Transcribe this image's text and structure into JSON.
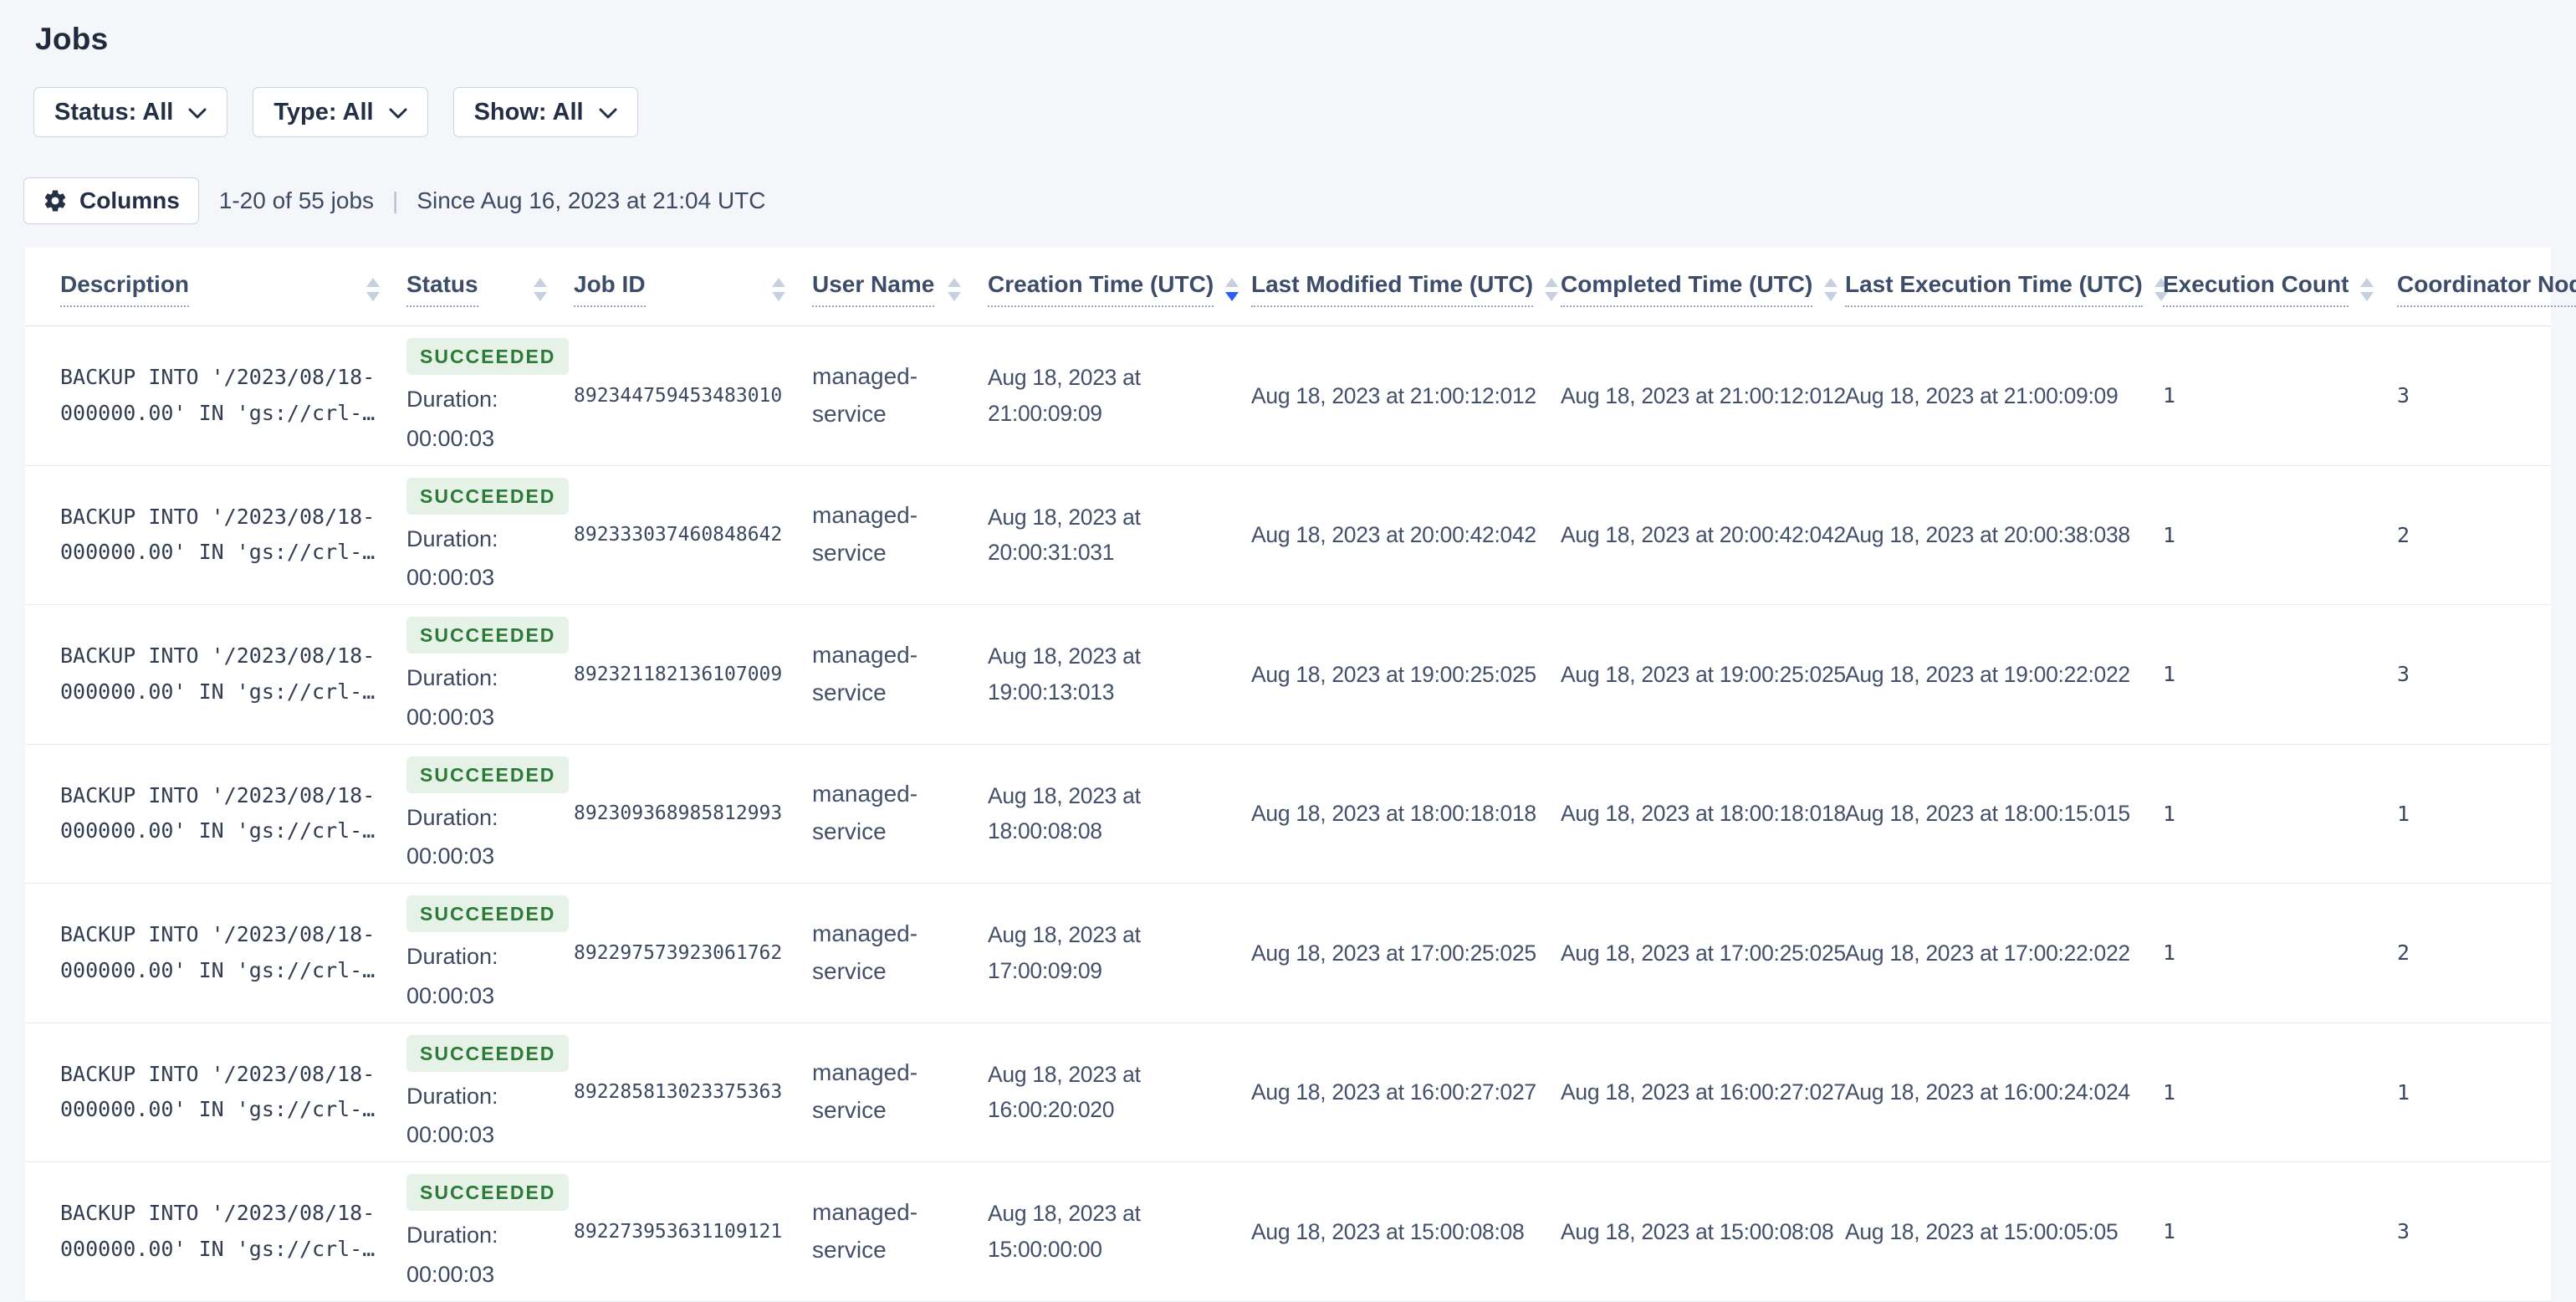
{
  "page_title": "Jobs",
  "filters": [
    {
      "label": "Status: All"
    },
    {
      "label": "Type: All"
    },
    {
      "label": "Show: All"
    }
  ],
  "toolbar": {
    "columns_button": "Columns",
    "results_count": "1-20 of 55 jobs",
    "separator": "|",
    "since": "Since Aug 16, 2023 at 21:04 UTC"
  },
  "colors": {
    "accent_blue": "#2a5ffa",
    "success_text": "#2b7a35",
    "success_bg": "#e6f2e7"
  },
  "table": {
    "columns": [
      {
        "key": "description",
        "label": "Description",
        "sort": "none"
      },
      {
        "key": "status",
        "label": "Status",
        "sort": "none"
      },
      {
        "key": "job_id",
        "label": "Job ID",
        "sort": "none"
      },
      {
        "key": "user_name",
        "label": "User Name",
        "sort": "none"
      },
      {
        "key": "creation_time",
        "label": "Creation Time (UTC)",
        "sort": "desc"
      },
      {
        "key": "last_modified_time",
        "label": "Last Modified Time (UTC)",
        "sort": "none"
      },
      {
        "key": "completed_time",
        "label": "Completed Time (UTC)",
        "sort": "none"
      },
      {
        "key": "last_execution_time",
        "label": "Last Execution Time (UTC)",
        "sort": "none"
      },
      {
        "key": "execution_count",
        "label": "Execution Count",
        "sort": "none"
      },
      {
        "key": "coordinator_node",
        "label": "Coordinator Node",
        "sort": "none"
      }
    ],
    "rows": [
      {
        "description_line1": "BACKUP INTO '/2023/08/18-",
        "description_line2": "000000.00' IN 'gs://crl-…",
        "status": "SUCCEEDED",
        "duration_label": "Duration:",
        "duration": "00:00:03",
        "job_id": "892344759453483010",
        "user_name": "managed-service",
        "creation_time": "Aug 18, 2023 at 21:00:09:09",
        "last_modified_time": "Aug 18, 2023 at 21:00:12:012",
        "completed_time": "Aug 18, 2023 at 21:00:12:012",
        "last_execution_time": "Aug 18, 2023 at 21:00:09:09",
        "execution_count": "1",
        "coordinator_node": "3"
      },
      {
        "description_line1": "BACKUP INTO '/2023/08/18-",
        "description_line2": "000000.00' IN 'gs://crl-…",
        "status": "SUCCEEDED",
        "duration_label": "Duration:",
        "duration": "00:00:03",
        "job_id": "892333037460848642",
        "user_name": "managed-service",
        "creation_time": "Aug 18, 2023 at 20:00:31:031",
        "last_modified_time": "Aug 18, 2023 at 20:00:42:042",
        "completed_time": "Aug 18, 2023 at 20:00:42:042",
        "last_execution_time": "Aug 18, 2023 at 20:00:38:038",
        "execution_count": "1",
        "coordinator_node": "2"
      },
      {
        "description_line1": "BACKUP INTO '/2023/08/18-",
        "description_line2": "000000.00' IN 'gs://crl-…",
        "status": "SUCCEEDED",
        "duration_label": "Duration:",
        "duration": "00:00:03",
        "job_id": "892321182136107009",
        "user_name": "managed-service",
        "creation_time": "Aug 18, 2023 at 19:00:13:013",
        "last_modified_time": "Aug 18, 2023 at 19:00:25:025",
        "completed_time": "Aug 18, 2023 at 19:00:25:025",
        "last_execution_time": "Aug 18, 2023 at 19:00:22:022",
        "execution_count": "1",
        "coordinator_node": "3"
      },
      {
        "description_line1": "BACKUP INTO '/2023/08/18-",
        "description_line2": "000000.00' IN 'gs://crl-…",
        "status": "SUCCEEDED",
        "duration_label": "Duration:",
        "duration": "00:00:03",
        "job_id": "892309368985812993",
        "user_name": "managed-service",
        "creation_time": "Aug 18, 2023 at 18:00:08:08",
        "last_modified_time": "Aug 18, 2023 at 18:00:18:018",
        "completed_time": "Aug 18, 2023 at 18:00:18:018",
        "last_execution_time": "Aug 18, 2023 at 18:00:15:015",
        "execution_count": "1",
        "coordinator_node": "1"
      },
      {
        "description_line1": "BACKUP INTO '/2023/08/18-",
        "description_line2": "000000.00' IN 'gs://crl-…",
        "status": "SUCCEEDED",
        "duration_label": "Duration:",
        "duration": "00:00:03",
        "job_id": "892297573923061762",
        "user_name": "managed-service",
        "creation_time": "Aug 18, 2023 at 17:00:09:09",
        "last_modified_time": "Aug 18, 2023 at 17:00:25:025",
        "completed_time": "Aug 18, 2023 at 17:00:25:025",
        "last_execution_time": "Aug 18, 2023 at 17:00:22:022",
        "execution_count": "1",
        "coordinator_node": "2"
      },
      {
        "description_line1": "BACKUP INTO '/2023/08/18-",
        "description_line2": "000000.00' IN 'gs://crl-…",
        "status": "SUCCEEDED",
        "duration_label": "Duration:",
        "duration": "00:00:03",
        "job_id": "892285813023375363",
        "user_name": "managed-service",
        "creation_time": "Aug 18, 2023 at 16:00:20:020",
        "last_modified_time": "Aug 18, 2023 at 16:00:27:027",
        "completed_time": "Aug 18, 2023 at 16:00:27:027",
        "last_execution_time": "Aug 18, 2023 at 16:00:24:024",
        "execution_count": "1",
        "coordinator_node": "1"
      },
      {
        "description_line1": "BACKUP INTO '/2023/08/18-",
        "description_line2": "000000.00' IN 'gs://crl-…",
        "status": "SUCCEEDED",
        "duration_label": "Duration:",
        "duration": "00:00:03",
        "job_id": "892273953631109121",
        "user_name": "managed-service",
        "creation_time": "Aug 18, 2023 at 15:00:00:00",
        "last_modified_time": "Aug 18, 2023 at 15:00:08:08",
        "completed_time": "Aug 18, 2023 at 15:00:08:08",
        "last_execution_time": "Aug 18, 2023 at 15:00:05:05",
        "execution_count": "1",
        "coordinator_node": "3"
      }
    ]
  }
}
